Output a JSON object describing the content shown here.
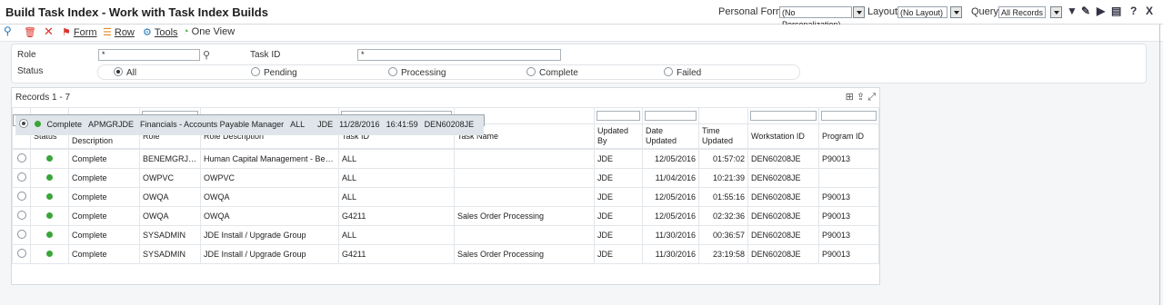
{
  "window": {
    "title": "Build Task Index - Work with Task Index Builds",
    "personal_form_label": "Personal Form:",
    "personal_form_value": "(No Personalization)",
    "layout_label": "Layout:",
    "layout_value": "(No Layout)",
    "query_label": "Query:",
    "query_value": "All Records"
  },
  "toolbar": {
    "form": "Form",
    "row": "Row",
    "tools": "Tools",
    "one_view": "One View"
  },
  "criteria": {
    "role_label": "Role",
    "role_value": "*",
    "task_id_label": "Task ID",
    "task_id_value": "*",
    "status_label": "Status",
    "options": [
      "All",
      "Pending",
      "Processing",
      "Complete",
      "Failed"
    ],
    "selected": "All"
  },
  "grid": {
    "records": "Records 1 - 7",
    "headers": {
      "status": "Status",
      "status_desc": "Status Description",
      "role": "Role",
      "role_desc": "Role Description",
      "task_id": "Task ID",
      "task_name": "Task Name",
      "updated_by": "Updated By",
      "date_updated": "Date Updated",
      "time_updated": "Time Updated",
      "workstation": "Workstation ID",
      "program": "Program ID"
    },
    "rows": [
      {
        "status_desc": "Complete",
        "role": "APMGRJDE",
        "role_desc": "Financials - Accounts Payable Manager",
        "task_id": "ALL",
        "task_name": "",
        "updated_by": "JDE",
        "date": "11/28/2016",
        "time": "16:41:59",
        "workstation": "DEN60208JE",
        "program": ""
      },
      {
        "status_desc": "Complete",
        "role": "BENEMGRJDE",
        "role_desc": "Human Capital Management - Benefits ...",
        "task_id": "ALL",
        "task_name": "",
        "updated_by": "JDE",
        "date": "12/05/2016",
        "time": "01:57:02",
        "workstation": "DEN60208JE",
        "program": "P90013"
      },
      {
        "status_desc": "Complete",
        "role": "OWPVC",
        "role_desc": "OWPVC",
        "task_id": "ALL",
        "task_name": "",
        "updated_by": "JDE",
        "date": "11/04/2016",
        "time": "10:21:39",
        "workstation": "DEN60208JE",
        "program": ""
      },
      {
        "status_desc": "Complete",
        "role": "OWQA",
        "role_desc": "OWQA",
        "task_id": "ALL",
        "task_name": "",
        "updated_by": "JDE",
        "date": "12/05/2016",
        "time": "01:55:16",
        "workstation": "DEN60208JE",
        "program": "P90013"
      },
      {
        "status_desc": "Complete",
        "role": "OWQA",
        "role_desc": "OWQA",
        "task_id": "G4211",
        "task_name": "Sales Order Processing",
        "updated_by": "JDE",
        "date": "12/05/2016",
        "time": "02:32:36",
        "workstation": "DEN60208JE",
        "program": "P90013"
      },
      {
        "status_desc": "Complete",
        "role": "SYSADMIN",
        "role_desc": "JDE Install / Upgrade Group",
        "task_id": "ALL",
        "task_name": "",
        "updated_by": "JDE",
        "date": "11/30/2016",
        "time": "00:36:57",
        "workstation": "DEN60208JE",
        "program": "P90013"
      },
      {
        "status_desc": "Complete",
        "role": "SYSADMIN",
        "role_desc": "JDE Install / Upgrade Group",
        "task_id": "G4211",
        "task_name": "Sales Order Processing",
        "updated_by": "JDE",
        "date": "11/30/2016",
        "time": "23:19:58",
        "workstation": "DEN60208JE",
        "program": "P90013"
      }
    ]
  },
  "colors": {
    "status_complete": "#3aa538",
    "selected_row": "#dfe5ea",
    "delete_icon": "#d9342b",
    "toolbar_icon": "#2a7ab8"
  }
}
